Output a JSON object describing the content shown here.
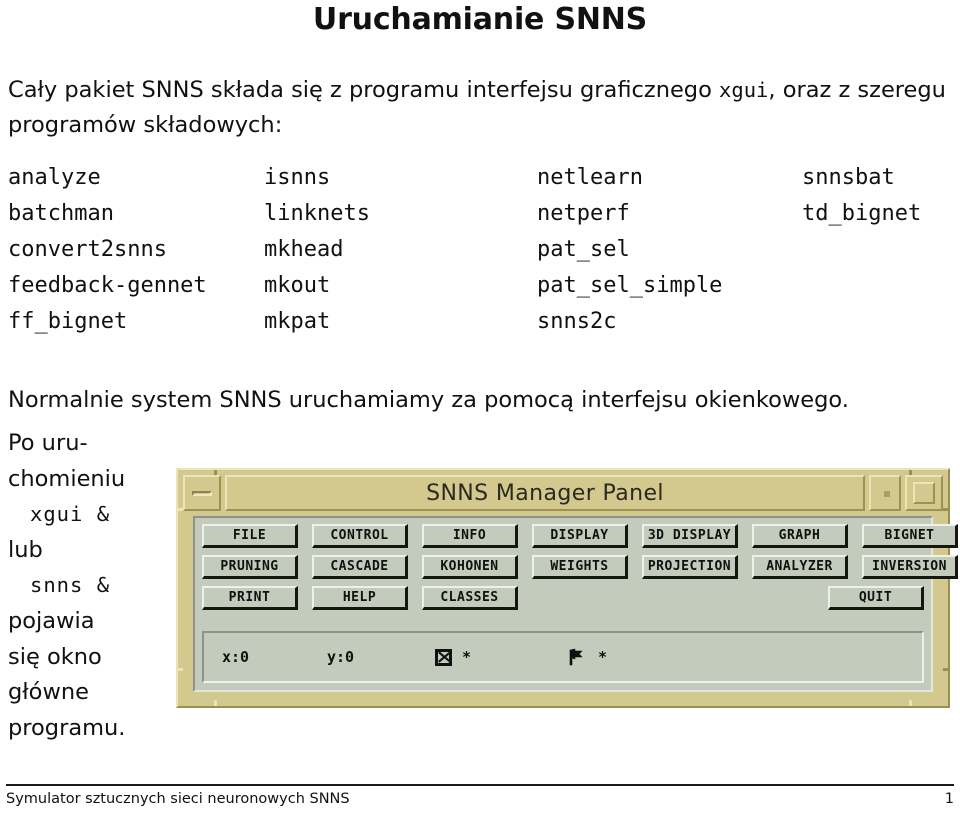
{
  "slide": {
    "title": "Uruchamianie SNNS",
    "intro_part1": "Cały pakiet SNNS składa się z programu interfejsu graficznego ",
    "intro_mono": "xgui",
    "intro_part2": ", oraz z szeregu programów składowych:",
    "normalnie": "Normalnie system SNNS uruchamiamy za pomocą interfejsu okienkowego."
  },
  "programs": {
    "rows": [
      {
        "c0": "analyze",
        "c1": "isnns",
        "c2": "netlearn",
        "c3": "snnsbat"
      },
      {
        "c0": "batchman",
        "c1": "linknets",
        "c2": "netperf",
        "c3": "td_bignet"
      },
      {
        "c0": "convert2snns",
        "c1": "mkhead",
        "c2": "pat_sel",
        "c3": ""
      },
      {
        "c0": "feedback-gennet",
        "c1": "mkout",
        "c2": "pat_sel_simple",
        "c3": ""
      },
      {
        "c0": "ff_bignet",
        "c1": "mkpat",
        "c2": "snns2c",
        "c3": ""
      }
    ]
  },
  "sidecol": {
    "lines": [
      {
        "text": "Po uru-",
        "indent": false,
        "mono": false
      },
      {
        "text": "chomieniu",
        "indent": false,
        "mono": false
      },
      {
        "text": "xgui &",
        "indent": true,
        "mono": true
      },
      {
        "text": "lub",
        "indent": false,
        "mono": false
      },
      {
        "text": "snns &",
        "indent": true,
        "mono": true
      },
      {
        "text": "pojawia",
        "indent": false,
        "mono": false
      },
      {
        "text": "się okno",
        "indent": false,
        "mono": false
      },
      {
        "text": "główne",
        "indent": false,
        "mono": false
      },
      {
        "text": "programu.",
        "indent": false,
        "mono": false
      }
    ]
  },
  "snns_window": {
    "title": "SNNS Manager Panel",
    "minimize_label": "minimize",
    "maximize_label": "maximize",
    "menu_rows": [
      [
        "FILE",
        "CONTROL",
        "INFO",
        "DISPLAY",
        "3D DISPLAY",
        "GRAPH",
        "BIGNET"
      ],
      [
        "PRUNING",
        "CASCADE",
        "KOHONEN",
        "WEIGHTS",
        "PROJECTION",
        "ANALYZER",
        "INVERSION"
      ],
      [
        "PRINT",
        "HELP",
        "CLASSES"
      ]
    ],
    "quit_label": "QUIT",
    "status": {
      "x": "x:0",
      "y": "y:0",
      "star1": "*",
      "star2": "*"
    },
    "colors": {
      "frame": "#d3c88d",
      "client": "#c3cbbc",
      "button_shadow": "#15170f",
      "button_highlight": "#eef1eb"
    }
  },
  "footer": {
    "left": "Symulator sztucznych sieci neuronowych SNNS",
    "page": "1"
  }
}
